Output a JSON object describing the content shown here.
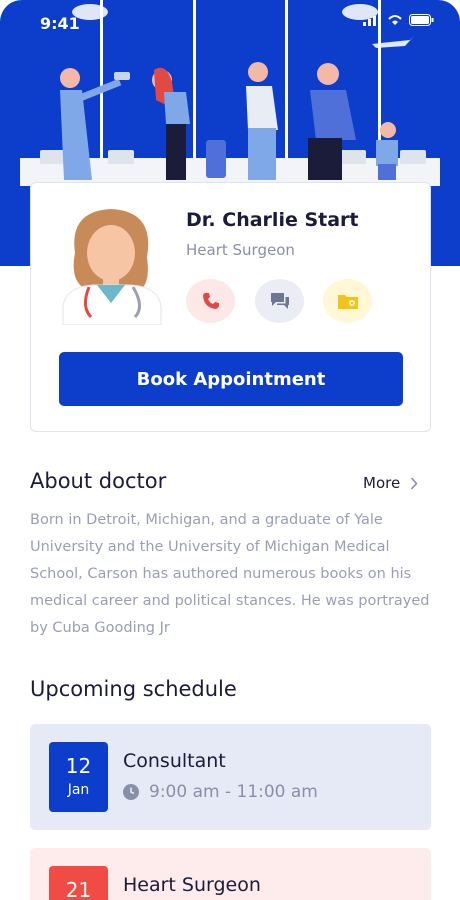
{
  "status_bar": {
    "time": "9:41"
  },
  "colors": {
    "primary": "#0c3ecb",
    "accent_red": "#f04c45",
    "muted_text": "#9a9eb5"
  },
  "doctor": {
    "name": "Dr. Charlie Start",
    "specialty": "Heart Surgeon",
    "actions": [
      "phone-icon",
      "chat-icon",
      "location-folder-icon"
    ],
    "book_label": "Book Appointment"
  },
  "about": {
    "title": "About doctor",
    "more_label": "More",
    "text": "Born in Detroit, Michigan, and a graduate of Yale University and the University of Michigan Medical School, Carson has authored numerous books on his medical career and political stances. He was portrayed by Cuba Gooding Jr"
  },
  "schedule": {
    "title": "Upcoming schedule",
    "items": [
      {
        "day": "12",
        "month": "Jan",
        "name": "Consultant",
        "time": "9:00 am - 11:00 am"
      },
      {
        "day": "21",
        "name": "Heart Surgeon"
      }
    ]
  }
}
